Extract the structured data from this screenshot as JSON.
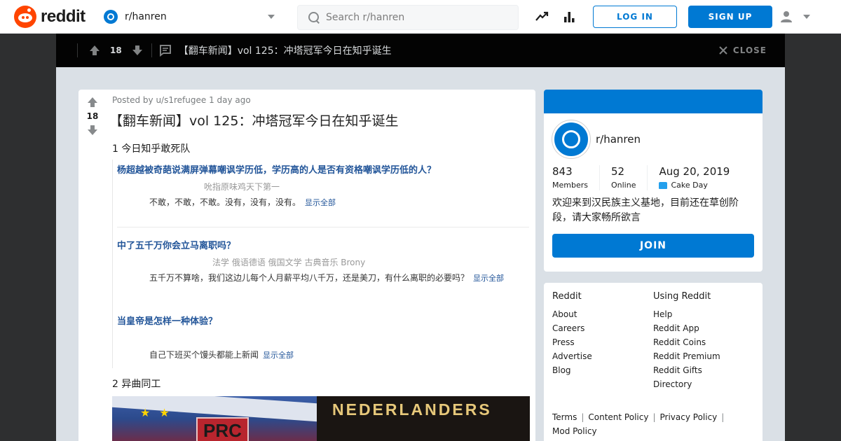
{
  "header": {
    "logo_text": "reddit",
    "subreddit": "r/hanren",
    "search_placeholder": "Search r/hanren",
    "login_label": "LOG IN",
    "signup_label": "SIGN UP",
    "icons": [
      "popular-icon",
      "stats-icon",
      "user-icon",
      "chevron-down-icon"
    ]
  },
  "post_bar": {
    "votes": "18",
    "title": "【翻车新闻】vol 125：冲塔冠军今日在知乎诞生",
    "close_label": "CLOSE"
  },
  "post": {
    "votes": "18",
    "meta": "Posted by u/s1refugee 1 day ago",
    "title": "【翻车新闻】vol 125：冲塔冠军今日在知乎诞生",
    "section1": "1 今日知乎敢死队",
    "zhihu": {
      "q1": "杨超越被奇葩说满屏弹幕嘲讽学历低，学历高的人是否有资格嘲讽学历低的人？",
      "q1_sub": "吮指原味鸡天下第一",
      "q1_ans": "不敢，不敢，不敢。没有，没有，没有。",
      "q2": "中了五千万你会立马离职吗？",
      "q2_sub": "法学 俄语德语 俄国文学 古典音乐 Brony",
      "q2_ans": "五千万不算啥，我们这边儿每个人月薪平均八千万，还是美刀，有什么离职的必要吗？",
      "q3": "当皇帝是怎样一种体验？",
      "q3_ans": "自己下班买个馒头都能上新闻",
      "more": "显示全部"
    },
    "section2": "2 异曲同工",
    "img_left_text": "PRC",
    "img_right_text": "NEDERLANDERS"
  },
  "about": {
    "name": "r/hanren",
    "members_val": "843",
    "members_lbl": "Members",
    "online_val": "52",
    "online_lbl": "Online",
    "cake_val": "Aug 20, 2019",
    "cake_lbl": "Cake Day",
    "description": "欢迎来到汉民族主义基地，目前还在草创阶段，请大家畅所欲言",
    "join_label": "JOIN",
    "accent": "#0079d3"
  },
  "links": {
    "col1_head": "Reddit",
    "col1": [
      "About",
      "Careers",
      "Press",
      "Advertise",
      "Blog"
    ],
    "col2_head": "Using Reddit",
    "col2": [
      "Help",
      "Reddit App",
      "Reddit Coins",
      "Reddit Premium",
      "Reddit Gifts",
      "Directory"
    ],
    "footer": [
      "Terms",
      "Content Policy",
      "Privacy Policy",
      "Mod Policy"
    ]
  }
}
